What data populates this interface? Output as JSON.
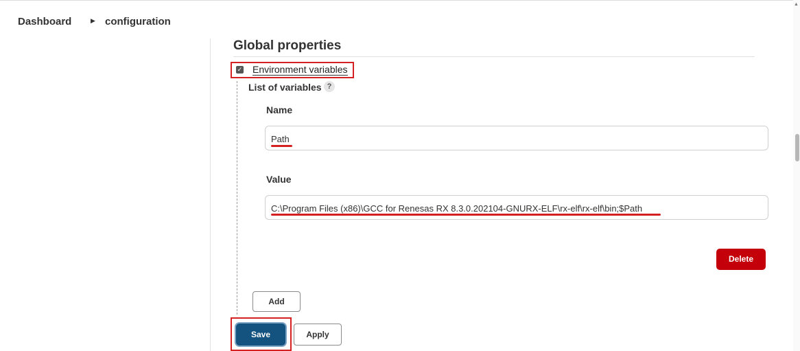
{
  "breadcrumb": {
    "items": [
      "Dashboard",
      "configuration"
    ]
  },
  "section": {
    "title": "Global properties",
    "env_checkbox_label": "Environment variables",
    "env_checked": true,
    "list_label": "List of variables",
    "help_glyph": "?"
  },
  "variable": {
    "name_label": "Name",
    "name_value": "Path",
    "value_label": "Value",
    "value_value": "C:\\Program Files (x86)\\GCC for Renesas RX 8.3.0.202104-GNURX-ELF\\rx-elf\\rx-elf\\bin;$Path"
  },
  "buttons": {
    "delete": "Delete",
    "add": "Add",
    "save": "Save",
    "apply": "Apply"
  },
  "colors": {
    "highlight_red": "#d42020",
    "delete_red": "#c4000a",
    "save_blue": "#14527f"
  },
  "icons": [
    "chevron-right-icon",
    "checkbox-checked-icon",
    "help-icon",
    "scroll-up-icon"
  ]
}
